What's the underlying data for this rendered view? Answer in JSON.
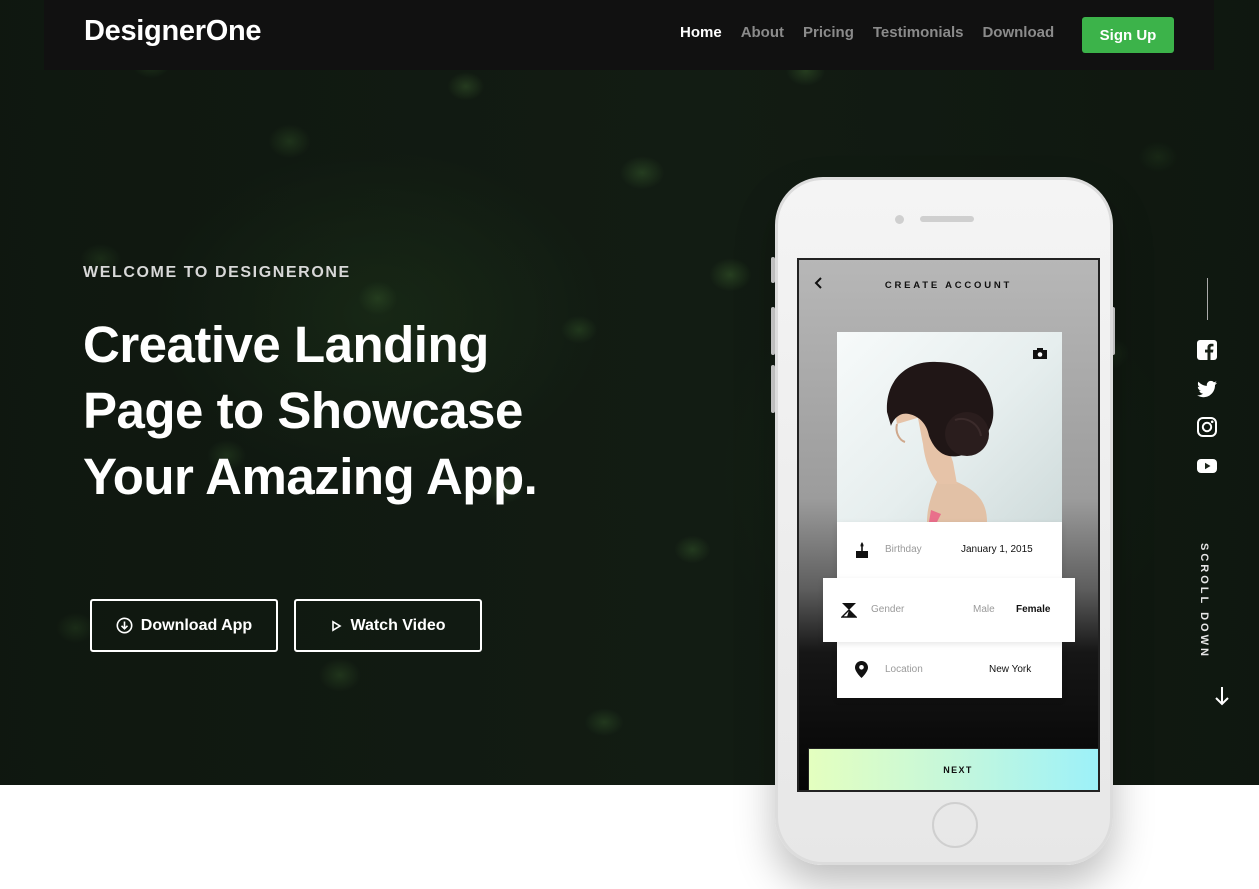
{
  "brand": {
    "logo_text": "DesignerOne"
  },
  "nav": {
    "items": [
      {
        "label": "Home",
        "active": true
      },
      {
        "label": "About",
        "active": false
      },
      {
        "label": "Pricing",
        "active": false
      },
      {
        "label": "Testimonials",
        "active": false
      },
      {
        "label": "Download",
        "active": false
      }
    ],
    "cta_label": "Sign Up"
  },
  "hero": {
    "kicker": "WELCOME TO DESIGNERONE",
    "headline_lines": [
      "Creative Landing",
      "Page to Showcase",
      "Your Amazing App."
    ],
    "buttons": {
      "download_label": "Download App",
      "video_label": "Watch Video"
    }
  },
  "phone_screen": {
    "title": "CREATE ACCOUNT",
    "rows": [
      {
        "label": "Birthday",
        "value": "January 1, 2015"
      },
      {
        "label": "Gender",
        "option_a": "Male",
        "option_b": "Female"
      },
      {
        "label": "Location",
        "value": "New York"
      }
    ],
    "next_label": "NEXT"
  },
  "social": [
    "facebook-icon",
    "twitter-icon",
    "instagram-icon",
    "youtube-icon"
  ],
  "scroll_label": "SCROLL DOWN",
  "colors": {
    "accent": "#3cb34a",
    "navbar": "#111111",
    "text_light": "#ffffff",
    "nav_inactive": "#8b8b8b"
  }
}
